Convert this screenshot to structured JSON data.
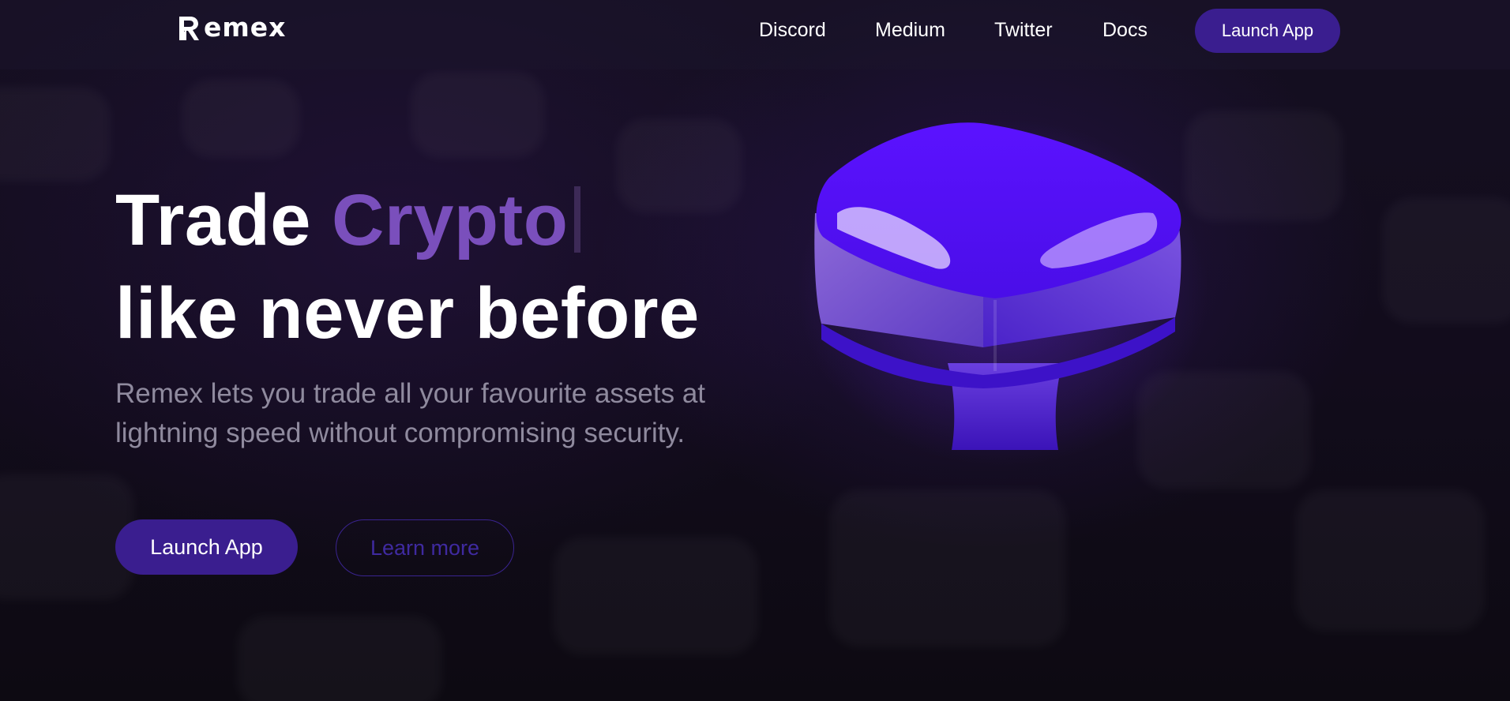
{
  "nav": {
    "logo_text": "emex",
    "links": [
      {
        "label": "Discord"
      },
      {
        "label": "Medium"
      },
      {
        "label": "Twitter"
      },
      {
        "label": "Docs"
      }
    ],
    "launch_label": "Launch App"
  },
  "hero": {
    "title_word_1": "Trade",
    "title_accent": "Crypto",
    "title_line_2": "like never before",
    "subtitle": "Remex lets you trade all your favourite assets at lightning speed without compromising security.",
    "primary_button": "Launch App",
    "secondary_button": "Learn more"
  },
  "colors": {
    "background": "#120c1c",
    "accent_purple": "#7a4fbc",
    "button_primary": "#3a1e8f",
    "subtitle_gray": "#8f8a9e",
    "cube_blue": "#5a14ff"
  },
  "icons": {
    "logo": "remex-logo-icon",
    "hero_art": "3d-purple-key-cube-icon"
  }
}
